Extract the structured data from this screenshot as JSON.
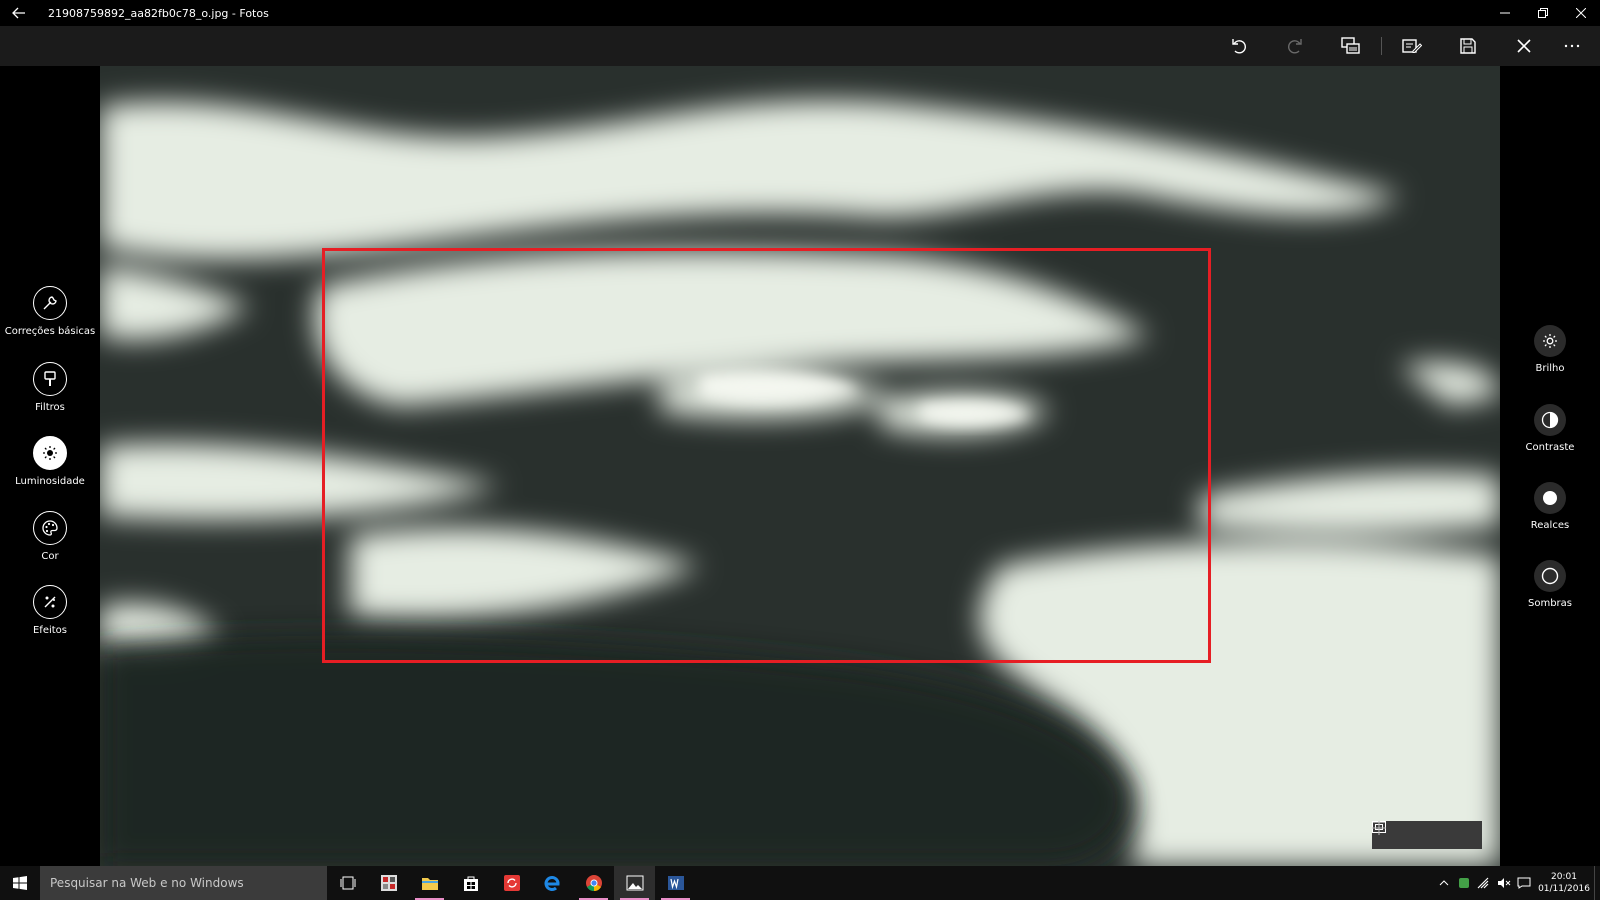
{
  "window": {
    "title": "21908759892_aa82fb0c78_o.jpg - Fotos"
  },
  "toolbar": {
    "icons": [
      "undo-icon",
      "redo-icon",
      "compare-icon",
      "save-copy-icon",
      "save-icon",
      "close-icon",
      "more-icon"
    ]
  },
  "left_panel": {
    "items": [
      {
        "label": "Correções básicas",
        "icon": "wrench-icon",
        "selected": false
      },
      {
        "label": "Filtros",
        "icon": "brush-icon",
        "selected": false
      },
      {
        "label": "Luminosidade",
        "icon": "sun-icon",
        "selected": true
      },
      {
        "label": "Cor",
        "icon": "palette-icon",
        "selected": false
      },
      {
        "label": "Efeitos",
        "icon": "effects-icon",
        "selected": false
      }
    ]
  },
  "right_panel": {
    "items": [
      {
        "label": "Brilho",
        "icon": "brightness-icon"
      },
      {
        "label": "Contraste",
        "icon": "contrast-icon"
      },
      {
        "label": "Realces",
        "icon": "highlights-icon"
      },
      {
        "label": "Sombras",
        "icon": "shadows-icon"
      }
    ]
  },
  "colors": {
    "selection": "#e61e24",
    "photo_light": "#e8efe6",
    "photo_dark": "#29302d",
    "running_indicator": "#e88ec8"
  },
  "taskbar": {
    "search_placeholder": "Pesquisar na Web e no Windows",
    "time": "20:01",
    "date": "01/11/2016"
  }
}
